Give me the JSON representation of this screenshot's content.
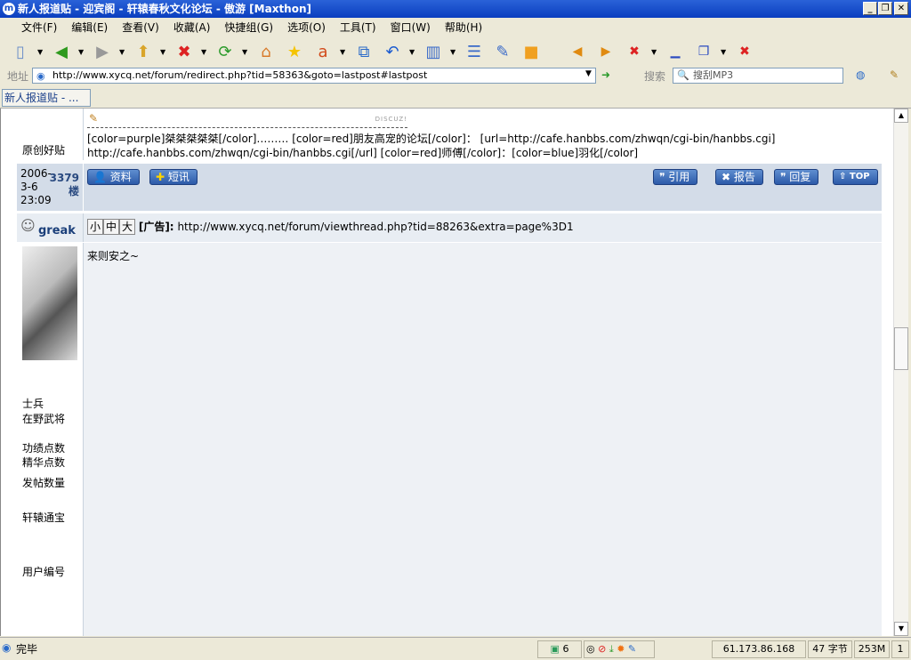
{
  "window": {
    "title": "新人报道贴 - 迎宾阁 - 轩辕春秋文化论坛 - 傲游 [Maxthon]"
  },
  "menu": [
    "文件(F)",
    "编辑(E)",
    "查看(V)",
    "收藏(A)",
    "快捷组(G)",
    "选项(O)",
    "工具(T)",
    "窗口(W)",
    "帮助(H)"
  ],
  "address": {
    "label": "地址",
    "url": "http://www.xycq.net/forum/redirect.php?tid=58363&goto=lastpost#lastpost",
    "search_label": "搜索",
    "search_placeholder": "搜刮MP3"
  },
  "tab": {
    "label": "新人报道贴 - ..."
  },
  "prev_post": {
    "signature_label": "原创好贴",
    "discuz": "DISCUZ!",
    "sig_line1": "[color=purple]桀桀桀桀桀[/color]……… [color=red]朋友高宠的论坛[/color]： [url=http://cafe.hanbbs.com/zhwqn/cgi-bin/hanbbs.cgi]",
    "sig_line2": "http://cafe.hanbbs.com/zhwqn/cgi-bin/hanbbs.cgi[/url] [color=red]师傅[/color]：[color=blue]羽化[/color]",
    "date1": "2006-",
    "date2": "3-6",
    "time": "23:09",
    "floor_num": "3379",
    "floor_label": "楼",
    "buttons": {
      "profile": "资料",
      "pm": "短讯",
      "quote": "引用",
      "report": "报告",
      "reply": "回复",
      "top": "TOP"
    }
  },
  "post": {
    "username": "greak",
    "font_sizes": [
      "小",
      "中",
      "大"
    ],
    "ad_label": "[广告]:",
    "ad_url": "http://www.xycq.net/forum/viewthread.php?tid=88263&extra=page%3D1",
    "body": "来则安之~",
    "rank1": "士兵",
    "rank2": "在野武将",
    "stats": [
      "功绩点数",
      "精华点数",
      "发帖数量",
      "轩辕通宝",
      "用户编号"
    ]
  },
  "status": {
    "text": "完毕",
    "count": "6",
    "ip": "61.173.86.168",
    "bytes": "47 字节",
    "memory": "253M",
    "num": "1"
  }
}
